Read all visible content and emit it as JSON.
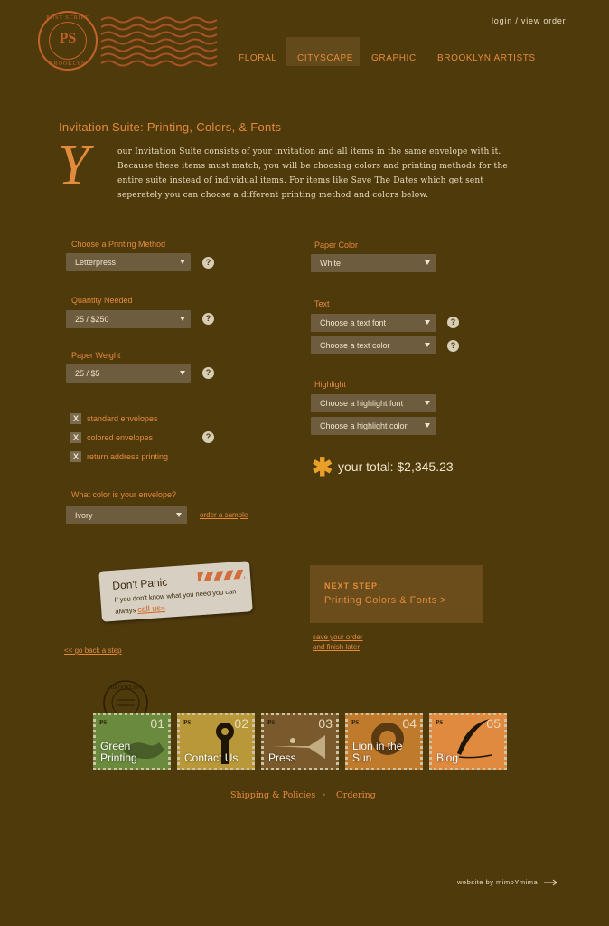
{
  "header": {
    "logo_text": "PS",
    "logo_top": "POST SCRIPT",
    "logo_bottom": "BROOKLYN",
    "login_link": "login / view order",
    "nav": [
      "FLORAL",
      "CITYSCAPE",
      "GRAPHIC",
      "BROOKLYN ARTISTS"
    ],
    "active_nav": "CITYSCAPE"
  },
  "section": {
    "title": "Invitation Suite: Printing, Colors, & Fonts",
    "dropcap": "Y",
    "intro": "our Invitation Suite consists of your invitation and all items in the same envelope with it. Because these items must match, you will be choosing colors and printing methods for the entire suite instead of individual items.  For items like Save The Dates which get sent seperately you can choose a different printing method and colors below."
  },
  "form": {
    "printing_label": "Choose a Printing Method",
    "printing_value": "Letterpress",
    "quantity_label": "Quantity Needed",
    "quantity_value": "25 / $250",
    "weight_label": "Paper Weight",
    "weight_value": "25 / $5",
    "envelopes": [
      {
        "label": "standard envelopes",
        "mark": "X"
      },
      {
        "label": "colored envelopes",
        "mark": "X"
      },
      {
        "label": "return address printing",
        "mark": "X"
      }
    ],
    "envelope_color_label": "What color is your envelope?",
    "envelope_color_value": "Ivory",
    "order_sample": "order a sample",
    "paper_color_label": "Paper Color",
    "paper_color_value": "White",
    "text_label": "Text",
    "text_font": "Choose a text font",
    "text_color": "Choose a text color",
    "highlight_label": "Highlight",
    "highlight_font": "Choose a highlight font",
    "highlight_color": "Choose a highlight color",
    "help": "?",
    "total_label": "your total:",
    "total_value": "$2,345.23"
  },
  "panic": {
    "title": "Don't Panic",
    "body": "If you don't know what you need you can always",
    "call": "call us»"
  },
  "next_step": {
    "label": "NEXT STEP:",
    "target": "Printing Colors & Fonts >"
  },
  "links": {
    "back": "<< go back a step",
    "save": "save your order",
    "save2": "and finish later"
  },
  "postmark": "BROOKLYN",
  "stamps": [
    {
      "num": "01",
      "caption": "Green Printing",
      "color": "#6a8a3e"
    },
    {
      "num": "02",
      "caption": "Contact Us",
      "color": "#b89838"
    },
    {
      "num": "03",
      "caption": "Press",
      "color": "#7a5a2c"
    },
    {
      "num": "04",
      "caption": "Lion in the Sun",
      "color": "#c07a2c"
    },
    {
      "num": "05",
      "caption": "Blog",
      "color": "#e08a40"
    }
  ],
  "footer": {
    "shipping": "Shipping & Policies",
    "separator": "•",
    "ordering": "Ordering",
    "credit": "website by mimoYmima"
  }
}
